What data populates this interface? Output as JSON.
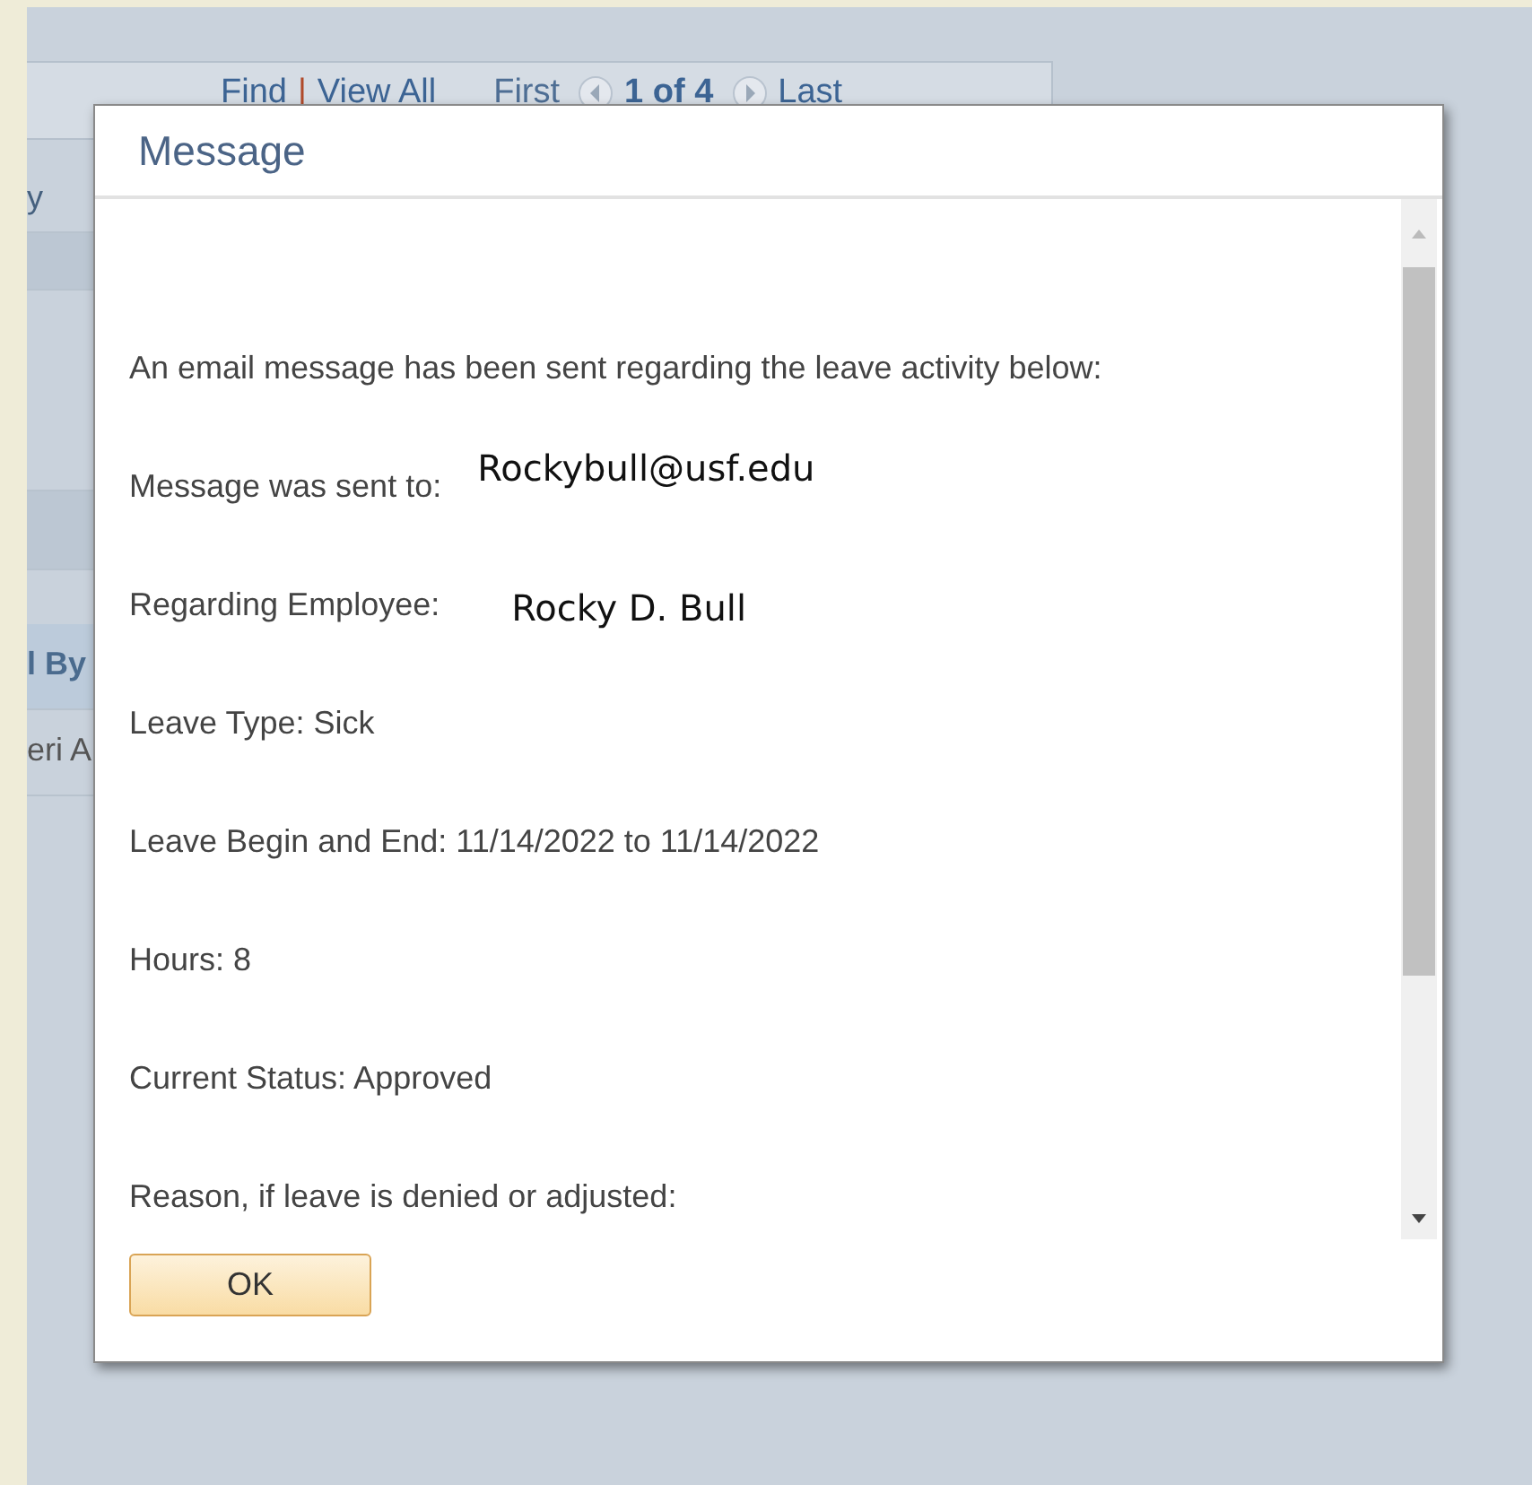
{
  "background_page": {
    "nav": {
      "find": "Find",
      "separator": "|",
      "view_all": "View All",
      "first": "First",
      "counter": "1 of 4",
      "last": "Last"
    },
    "left_column": [
      "y",
      "l By",
      "eri A"
    ]
  },
  "dialog": {
    "title": "Message",
    "lines": [
      {
        "kind": "text",
        "text": "An email message has been sent regarding the leave activity below:"
      },
      {
        "kind": "labeled",
        "label": "Message was sent to:",
        "value": "Rockybull@usf.edu"
      },
      {
        "kind": "labeled",
        "label": "Regarding Employee:",
        "value": "Rocky D. Bull"
      },
      {
        "kind": "text",
        "text": "Leave Type: Sick"
      },
      {
        "kind": "text",
        "text": "Leave Begin and End: 11/14/2022 to 11/14/2022"
      },
      {
        "kind": "text",
        "text": "Hours: 8"
      },
      {
        "kind": "text",
        "text": "Current Status: Approved"
      },
      {
        "kind": "text",
        "text": "Reason, if leave is denied or adjusted:"
      }
    ],
    "buttons": [
      "OK"
    ]
  }
}
